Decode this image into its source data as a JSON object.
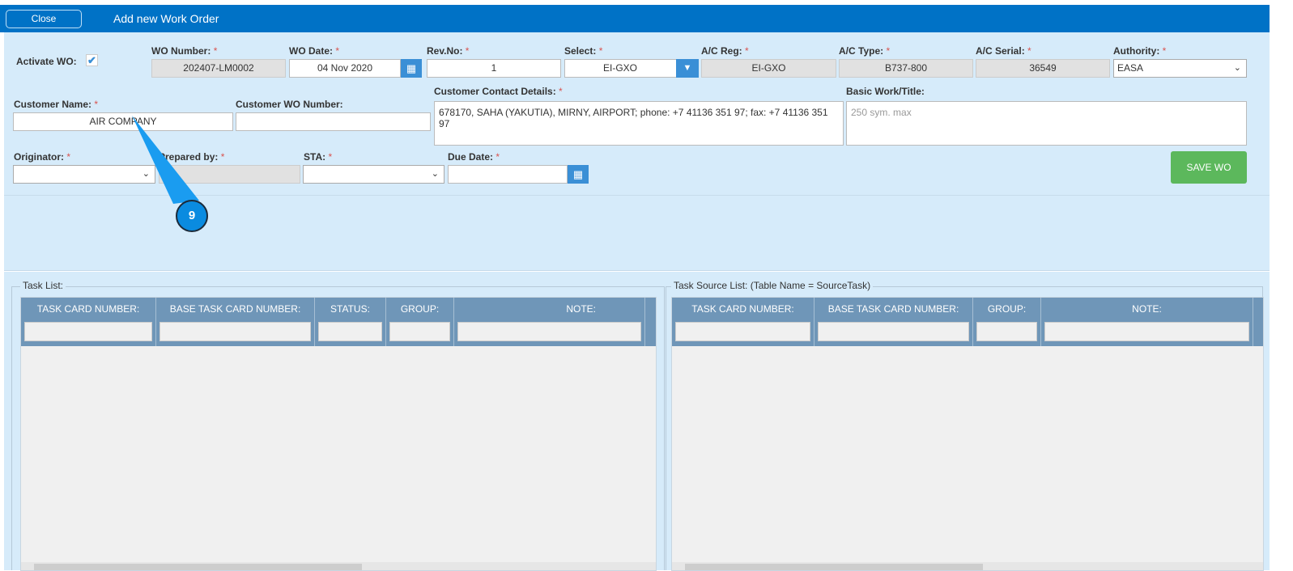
{
  "header": {
    "close_label": "Close",
    "title": "Add new Work Order"
  },
  "form": {
    "activate_wo_label": "Activate WO:",
    "activate_wo_checked": true,
    "wo_number": {
      "label": "WO Number:",
      "value": "202407-LM0002"
    },
    "wo_date": {
      "label": "WO Date:",
      "value": "04 Nov 2020"
    },
    "rev_no": {
      "label": "Rev.No:",
      "value": "1"
    },
    "select": {
      "label": "Select:",
      "value": "EI-GXO"
    },
    "ac_reg": {
      "label": "A/C Reg:",
      "value": "EI-GXO"
    },
    "ac_type": {
      "label": "A/C Type:",
      "value": "B737-800"
    },
    "ac_serial": {
      "label": "A/C Serial:",
      "value": "36549"
    },
    "authority": {
      "label": "Authority:",
      "value": "EASA"
    },
    "customer_name": {
      "label": "Customer Name:",
      "value": "AIR COMPANY"
    },
    "customer_wo_number": {
      "label": "Customer WO Number:",
      "value": ""
    },
    "customer_contact": {
      "label": "Customer Contact Details:",
      "value": "678170, SAHA (YAKUTIA), MIRNY, AIRPORT; phone: +7 41136 351 97; fax: +7 41136 351 97"
    },
    "basic_work": {
      "label": "Basic Work/Title:",
      "placeholder": "250 sym. max"
    },
    "originator": {
      "label": "Originator:",
      "value": ""
    },
    "prepared_by": {
      "label": "Prepared by:",
      "value": ""
    },
    "sta": {
      "label": "STA:",
      "value": ""
    },
    "due_date": {
      "label": "Due Date:",
      "value": ""
    },
    "required_mark": "*",
    "save_label": "SAVE WO"
  },
  "callout": {
    "number": "9"
  },
  "task_list": {
    "legend": "Task List:",
    "columns": [
      "TASK CARD NUMBER:",
      "BASE TASK CARD NUMBER:",
      "STATUS:",
      "GROUP:",
      "NOTE:"
    ]
  },
  "source_list": {
    "legend": "Task Source List: (Table Name = SourceTask)",
    "columns": [
      "TASK CARD NUMBER:",
      "BASE TASK CARD NUMBER:",
      "GROUP:",
      "NOTE:"
    ]
  }
}
